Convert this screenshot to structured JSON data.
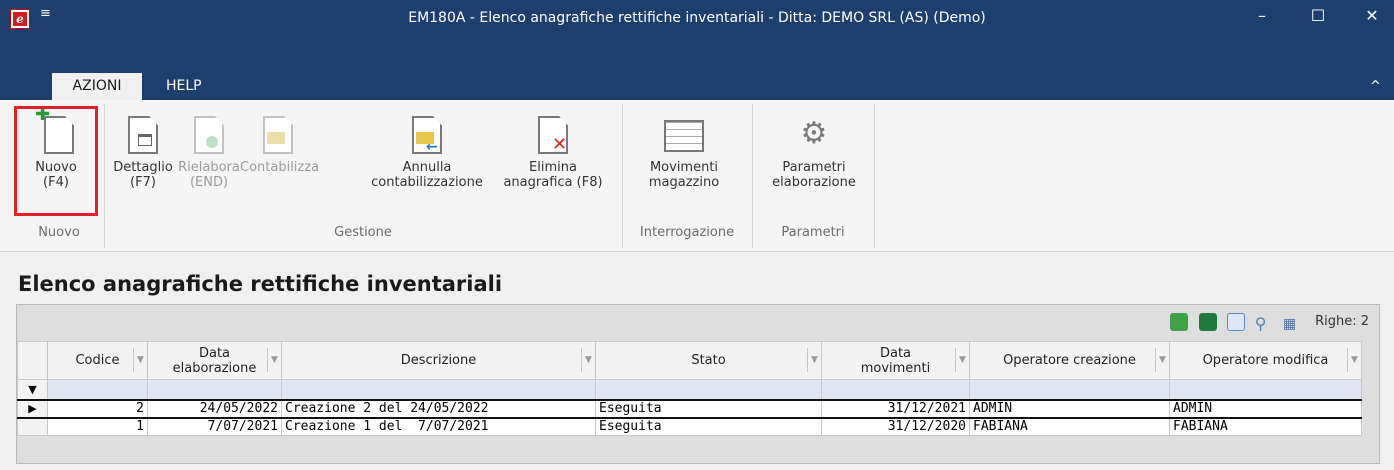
{
  "window": {
    "title": "EM180A - Elenco anagrafiche rettifiche inventariali - Ditta: DEMO SRL (AS)  (Demo)",
    "quick_access": "₹",
    "minimize": "–",
    "maximize": "☐",
    "close": "✕"
  },
  "tabs": [
    {
      "label": "AZIONI"
    },
    {
      "label": "HELP"
    }
  ],
  "ribbon": {
    "collapse": "^",
    "buttons": [
      {
        "label": "Nuovo\n(F4)"
      },
      {
        "label": "Dettaglio\n(F7)"
      },
      {
        "label": "Rielabora\n(END)"
      },
      {
        "label": "Contabilizza"
      },
      {
        "label": "Annulla\ncontabilizzazione"
      },
      {
        "label": "Elimina\nanagrafica (F8)"
      },
      {
        "label": "Movimenti\nmagazzino"
      },
      {
        "label": "Parametri\nelaborazione"
      }
    ],
    "groups": [
      "Nuovo",
      "Gestione",
      "Interrogazione",
      "Parametri"
    ]
  },
  "page_title": "Elenco anagrafiche rettifiche inventariali",
  "grid": {
    "rows_count": "Righe: 2",
    "columns": [
      "Codice",
      "Data\nelaborazione",
      "Descrizione",
      "Stato",
      "Data\nmovimenti",
      "Operatore creazione",
      "Operatore modifica"
    ],
    "rows": [
      {
        "indicator": "▶",
        "codice": "2",
        "data_elab": "24/05/2022",
        "descrizione": "Creazione 2 del 24/05/2022",
        "stato": "Eseguita",
        "data_mov": "31/12/2021",
        "op_creazione": "ADMIN",
        "op_modifica": "ADMIN"
      },
      {
        "indicator": "",
        "codice": "1",
        "data_elab": "7/07/2021",
        "descrizione": "Creazione 1 del  7/07/2021",
        "stato": "Eseguita",
        "data_mov": "31/12/2020",
        "op_creazione": "FABIANA",
        "op_modifica": "FABIANA"
      }
    ],
    "filter_icon": "▼"
  },
  "colors": {
    "titlebar": "#1e3f6e",
    "highlight": "#e21f26"
  }
}
